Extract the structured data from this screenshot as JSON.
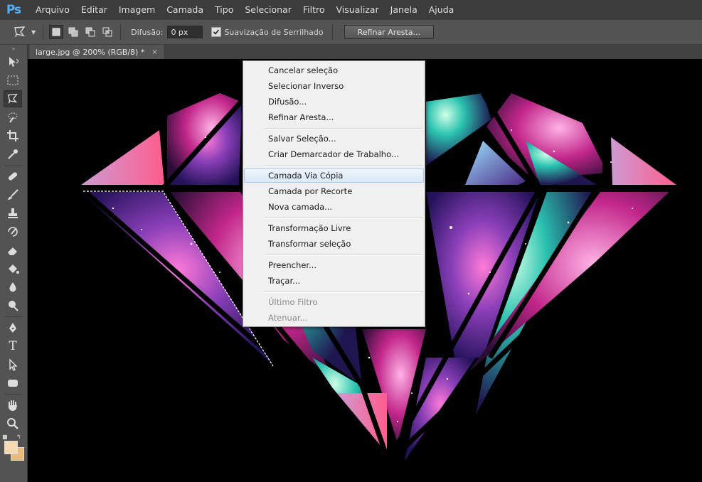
{
  "app": {
    "logo": "Ps"
  },
  "menubar": {
    "items": [
      "Arquivo",
      "Editar",
      "Imagem",
      "Camada",
      "Tipo",
      "Selecionar",
      "Filtro",
      "Visualizar",
      "Janela",
      "Ajuda"
    ]
  },
  "options": {
    "feather_label": "Difusão:",
    "feather_value": "0 px",
    "antialias_label": "Suavização de Serrilhado",
    "antialias_checked": true,
    "refine_button": "Refinar Aresta..."
  },
  "document": {
    "tab_title": "large.jpg @ 200% (RGB/8) *",
    "close_symbol": "×"
  },
  "toolbox": {
    "icons": [
      "move-icon",
      "marquee-icon",
      "polygonal-lasso-icon",
      "quick-selection-icon",
      "crop-icon",
      "eyedropper-icon",
      "healing-brush-icon",
      "brush-icon",
      "clone-stamp-icon",
      "history-brush-icon",
      "eraser-icon",
      "paint-bucket-icon",
      "blur-icon",
      "dodge-icon",
      "pen-icon",
      "type-icon",
      "path-selection-icon",
      "shape-icon",
      "hand-icon",
      "zoom-icon"
    ],
    "active_tool": "polygonal-lasso-icon",
    "type_glyph": "T",
    "foreground_color": "#f6d9b1",
    "background_color": "#e9b97d"
  },
  "context_menu": {
    "groups": [
      [
        {
          "label": "Cancelar seleção"
        },
        {
          "label": "Selecionar Inverso"
        },
        {
          "label": "Difusão..."
        },
        {
          "label": "Refinar Aresta..."
        }
      ],
      [
        {
          "label": "Salvar Seleção..."
        },
        {
          "label": "Criar Demarcador de Trabalho..."
        }
      ],
      [
        {
          "label": "Camada Via Cópia",
          "hover": true
        },
        {
          "label": "Camada por Recorte"
        },
        {
          "label": "Nova camada..."
        }
      ],
      [
        {
          "label": "Transformação Livre"
        },
        {
          "label": "Transformar seleção"
        }
      ],
      [
        {
          "label": "Preencher..."
        },
        {
          "label": "Traçar..."
        }
      ],
      [
        {
          "label": "Último Filtro",
          "disabled": true
        },
        {
          "label": "Atenuar...",
          "disabled": true
        }
      ]
    ]
  }
}
